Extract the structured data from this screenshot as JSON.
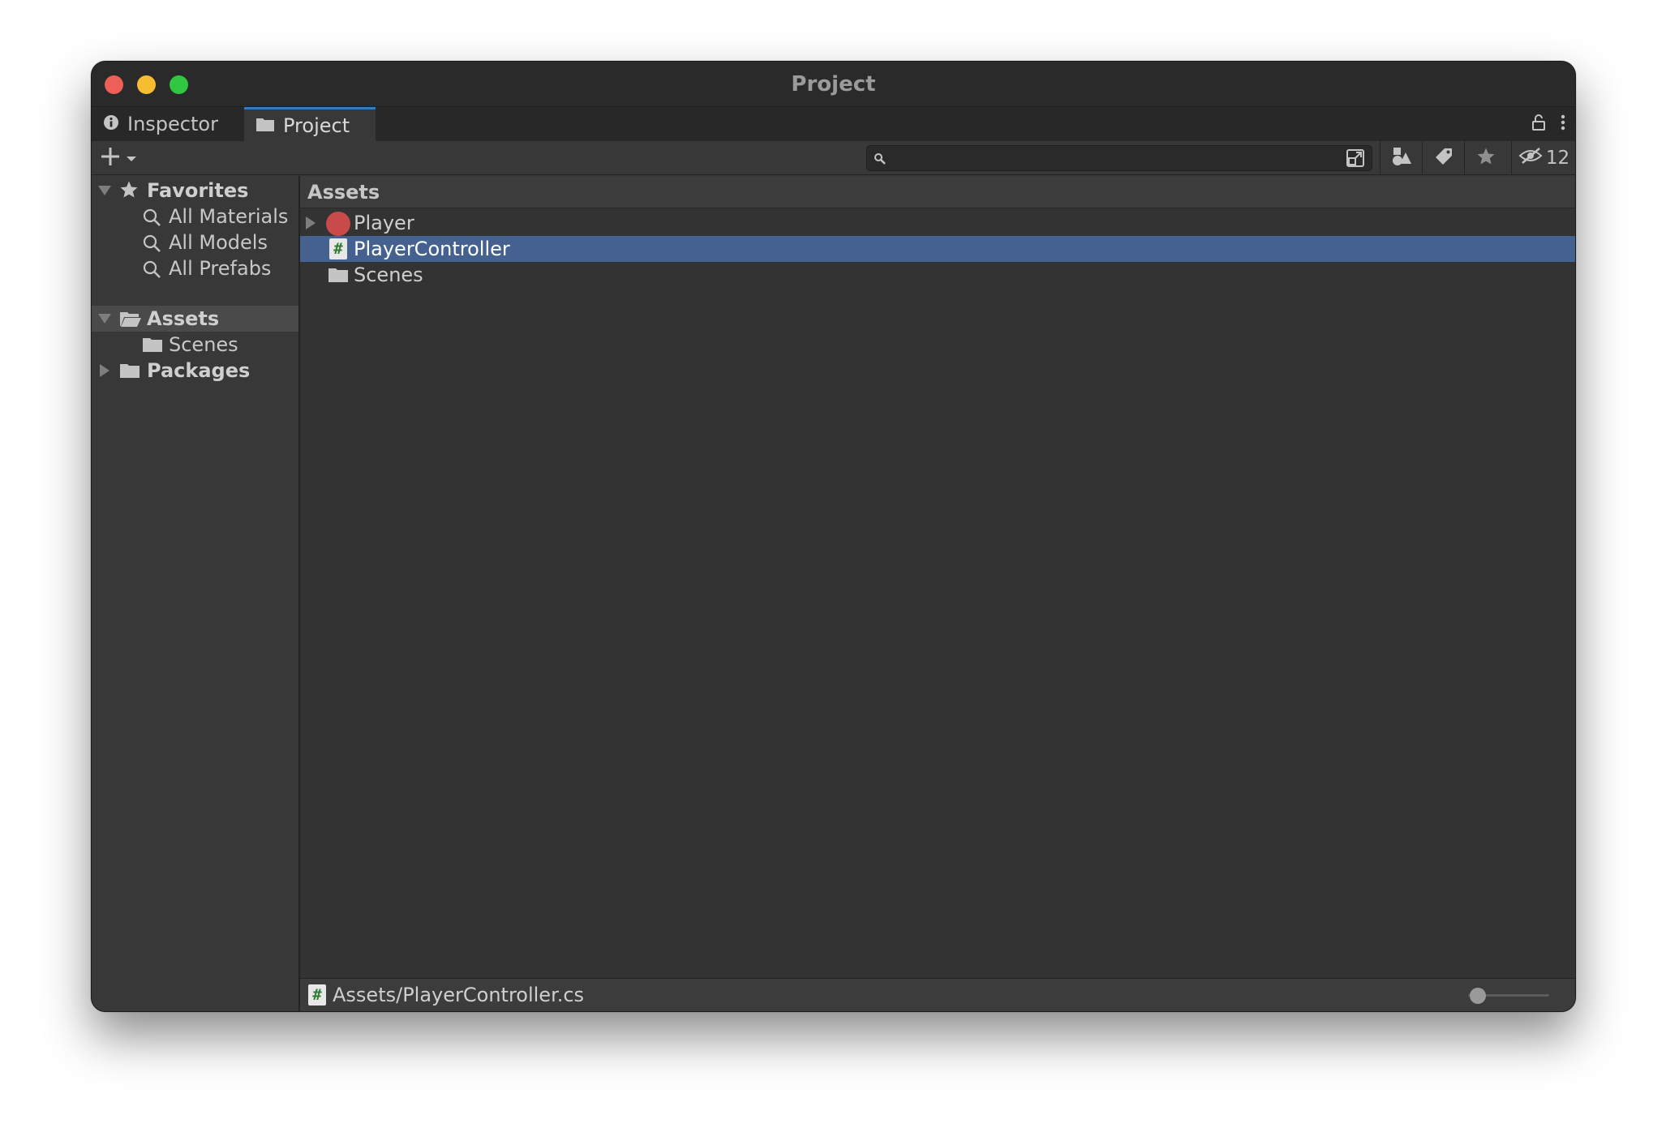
{
  "window": {
    "title": "Project"
  },
  "tabs": [
    {
      "label": "Inspector",
      "icon": "info-icon"
    },
    {
      "label": "Project",
      "icon": "folder-icon",
      "active": true
    }
  ],
  "toolbar": {
    "search_value": "",
    "hidden_count": "12"
  },
  "sidebar": {
    "favorites": {
      "label": "Favorites",
      "items": [
        "All Materials",
        "All Models",
        "All Prefabs"
      ]
    },
    "assets": {
      "label": "Assets",
      "children": [
        "Scenes"
      ]
    },
    "packages": {
      "label": "Packages"
    }
  },
  "content": {
    "breadcrumb": "Assets",
    "items": [
      {
        "name": "Player",
        "type": "prefab",
        "expandable": true
      },
      {
        "name": "PlayerController",
        "type": "script",
        "selected": true
      },
      {
        "name": "Scenes",
        "type": "folder"
      }
    ]
  },
  "status": {
    "path": "Assets/PlayerController.cs"
  },
  "colors": {
    "selection": "#44618f",
    "active_tab_accent": "#3a79bb",
    "prefab_red": "#c94a4a",
    "script_hash_green": "#2e7d32"
  }
}
